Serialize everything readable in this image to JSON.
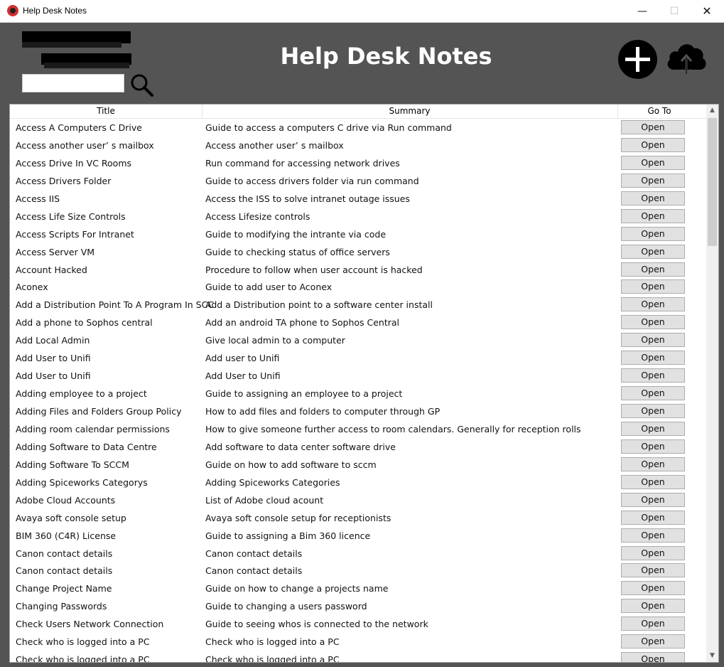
{
  "window": {
    "title": "Help Desk Notes",
    "minimize_glyph": "—",
    "maximize_glyph": "☐",
    "close_glyph": "✕"
  },
  "header": {
    "app_title": "Help Desk Notes",
    "search": {
      "value": "",
      "placeholder": ""
    },
    "icons": {
      "search": "search-icon",
      "add": "add-icon",
      "upload": "cloud-upload-icon"
    }
  },
  "table": {
    "columns": [
      "Title",
      "Summary",
      "Go To"
    ],
    "open_label": "Open",
    "rows": [
      {
        "title": "Access A Computers C Drive",
        "summary": "Guide to access a computers C drive via Run command"
      },
      {
        "title": "Access another user’ s mailbox",
        "summary": "Access another user’ s mailbox"
      },
      {
        "title": "Access Drive In VC Rooms",
        "summary": "Run command for accessing network drives"
      },
      {
        "title": "Access Drivers Folder",
        "summary": "Guide to access drivers folder  via run command"
      },
      {
        "title": "Access IIS",
        "summary": "Access the ISS to solve intranet outage issues"
      },
      {
        "title": "Access Life Size Controls",
        "summary": "Access Lifesize controls"
      },
      {
        "title": "Access Scripts For Intranet",
        "summary": "Guide to modifying the intrante via code"
      },
      {
        "title": "Access Server VM",
        "summary": "Guide to checking status of office servers"
      },
      {
        "title": "Account Hacked",
        "summary": "Procedure to follow when user account is hacked"
      },
      {
        "title": "Aconex",
        "summary": "Guide to add user to Aconex"
      },
      {
        "title": "Add a Distribution Point To A Program In SCC",
        "summary": "Add a Distribution point to a software center install"
      },
      {
        "title": "Add a phone to Sophos central",
        "summary": "Add an android TA phone to Sophos Central"
      },
      {
        "title": "Add Local Admin",
        "summary": "Give local admin to a computer"
      },
      {
        "title": "Add User to Unifi",
        "summary": "Add user to Unifi"
      },
      {
        "title": "Add User to Unifi",
        "summary": "Add User to Unifi"
      },
      {
        "title": "Adding employee to a project",
        "summary": "Guide to assigning an employee to a project"
      },
      {
        "title": "Adding Files and Folders Group Policy",
        "summary": "How to add files and folders to computer through GP"
      },
      {
        "title": "Adding room calendar permissions",
        "summary": "How to give someone further access to room calendars. Generally for reception rolls"
      },
      {
        "title": "Adding Software to Data Centre",
        "summary": "Add software to data center software drive"
      },
      {
        "title": "Adding Software To SCCM",
        "summary": "Guide on how to add software to sccm"
      },
      {
        "title": "Adding Spiceworks Categorys",
        "summary": "Adding Spiceworks Categories"
      },
      {
        "title": "Adobe Cloud Accounts",
        "summary": "List of Adobe cloud acount"
      },
      {
        "title": "Avaya soft console setup",
        "summary": "Avaya soft console setup for receptionists"
      },
      {
        "title": "BIM 360 (C4R) License",
        "summary": "Guide to assigning a Bim 360 licence"
      },
      {
        "title": "Canon contact details",
        "summary": "Canon contact details"
      },
      {
        "title": "Canon contact details",
        "summary": "Canon contact details"
      },
      {
        "title": "Change Project Name",
        "summary": "Guide on how to change a projects name"
      },
      {
        "title": "Changing Passwords",
        "summary": "Guide to changing a users password"
      },
      {
        "title": "Check Users Network Connection",
        "summary": "Guide to seeing whos is connected to the network"
      },
      {
        "title": "Check who is logged into a PC",
        "summary": "Check who is logged into a PC"
      },
      {
        "title": "Check who is logged into a PC",
        "summary": "Check who is logged into a PC"
      }
    ]
  },
  "scrollbar": {
    "up_glyph": "▲",
    "down_glyph": "▼"
  }
}
